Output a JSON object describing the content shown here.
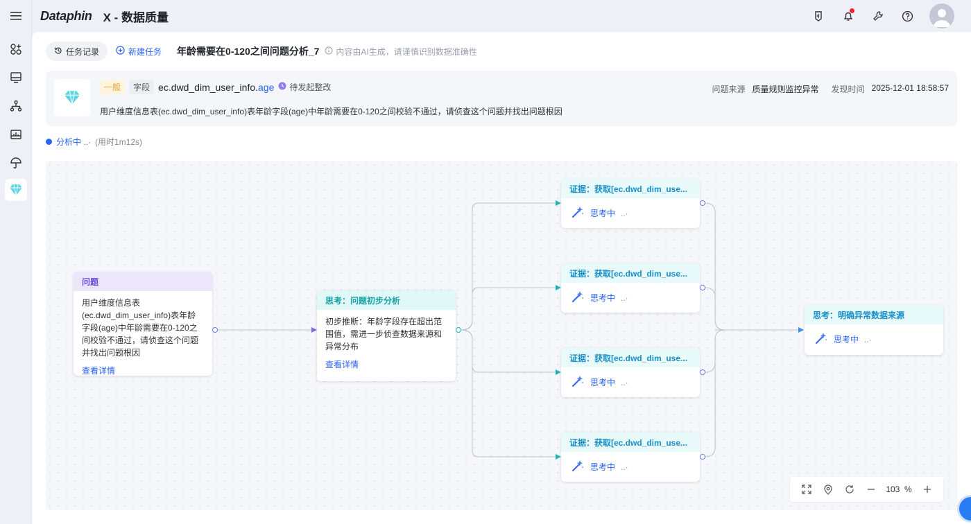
{
  "app": {
    "logo": "Dataphin",
    "title": "X - 数据质量"
  },
  "tabs": {
    "history": "任务记录",
    "new_task": "新建任务",
    "task_title": "年龄需要在0-120之间问题分析_7",
    "ai_hint": "内容由AI生成，请谨慎识别数据准确性"
  },
  "issue": {
    "level": "一般",
    "type": "字段",
    "table": "ec.dwd_dim_user_info.",
    "column": "age",
    "status": "待发起整改",
    "description": "用户维度信息表(ec.dwd_dim_user_info)表年龄字段(age)中年龄需要在0-120之间校验不通过，请侦查这个问题并找出问题根因",
    "source_label": "问题来源",
    "source_value": "质量规则监控异常",
    "found_label": "发现时间",
    "found_value": "2025-12-01 18:58:57"
  },
  "progress": {
    "status": "分析中 ..·",
    "elapsed": "(用时1m12s)"
  },
  "nodes": {
    "problem": {
      "title": "问题",
      "body": "用户维度信息表(ec.dwd_dim_user_info)表年龄字段(age)中年龄需要在0-120之间校验不通过，请侦查这个问题并找出问题根因",
      "link": "查看详情"
    },
    "think1": {
      "title": "思考：问题初步分析",
      "body": "初步推断：年龄字段存在超出范围值，需进一步侦查数据来源和异常分布",
      "link": "查看详情"
    },
    "evidence": [
      {
        "title": "证据：获取[ec.dwd_dim_use...",
        "status": "思考中",
        "dots": "..·"
      },
      {
        "title": "证据：获取[ec.dwd_dim_use...",
        "status": "思考中",
        "dots": "..·"
      },
      {
        "title": "证据：获取[ec.dwd_dim_use...",
        "status": "思考中",
        "dots": "..·"
      },
      {
        "title": "证据：获取[ec.dwd_dim_use...",
        "status": "思考中",
        "dots": "..·"
      }
    ],
    "think2": {
      "title": "思考：明确异常数据来源",
      "status": "思考中",
      "dots": "..·"
    }
  },
  "toolbar": {
    "zoom": "103",
    "unit": "%"
  },
  "colors": {
    "accent": "#2a63f5",
    "problem_header": "#ece6fb",
    "think_header": "#e0f8f7"
  },
  "icons": [
    "menu-icon",
    "apps-icon",
    "monitor-icon",
    "lineage-icon",
    "dashboard-icon",
    "umbrella-icon",
    "gem-icon",
    "badge-icon",
    "bell-icon",
    "tool-icon",
    "help-icon",
    "history-icon",
    "plus-circle-icon",
    "info-icon",
    "clock-icon",
    "magic-wand-icon",
    "fullscreen-icon",
    "locate-icon",
    "refresh-icon",
    "zoom-out-icon",
    "zoom-in-icon"
  ]
}
